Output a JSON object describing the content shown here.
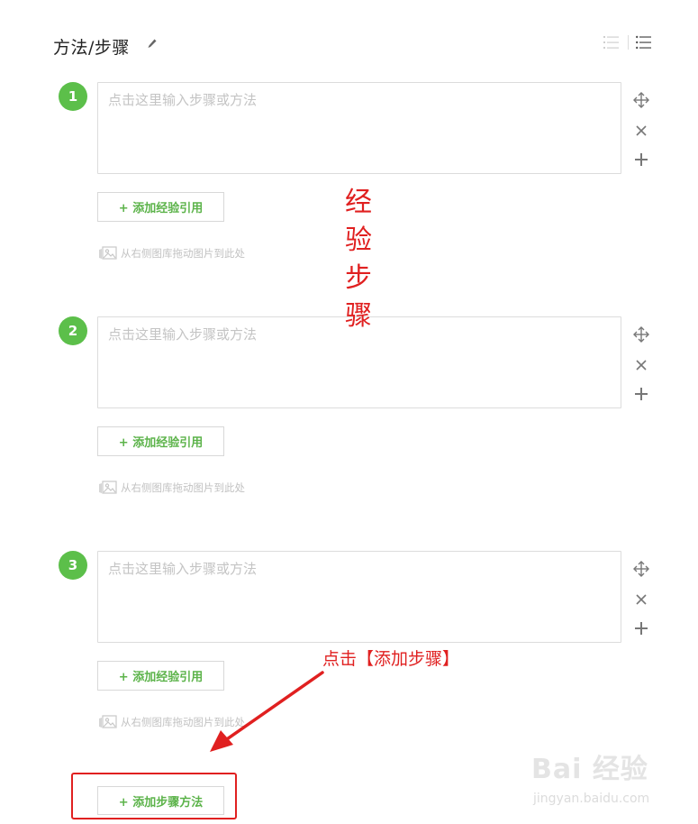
{
  "header": {
    "title": "方法/步骤",
    "edit_icon": "pencil-icon",
    "view_icons": [
      "numbered-list-icon",
      "bullet-list-icon"
    ]
  },
  "steps": [
    {
      "number": "1",
      "placeholder": "点击这里输入步骤或方法",
      "ref_label": "+ 添加经验引用",
      "drag_hint": "从右侧图库拖动图片到此处"
    },
    {
      "number": "2",
      "placeholder": "点击这里输入步骤或方法",
      "ref_label": "+ 添加经验引用",
      "drag_hint": "从右侧图库拖动图片到此处"
    },
    {
      "number": "3",
      "placeholder": "点击这里输入步骤或方法",
      "ref_label": "+ 添加经验引用",
      "drag_hint": "从右侧图库拖动图片到此处"
    }
  ],
  "step_tools": [
    "move-icon",
    "close-icon",
    "plus-icon"
  ],
  "footer": {
    "add_step_label": "+ 添加步骤方法"
  },
  "annotations": {
    "vertical_chars": [
      "经",
      "验",
      "步",
      "骤"
    ],
    "click_hint": "点击【添加步骤】",
    "color": "#e02020"
  },
  "watermark": {
    "logo": "Bai 经验",
    "url": "jingyan.baidu.com"
  },
  "colors": {
    "accent_green": "#5cbf4a",
    "button_text_green": "#5cb34a"
  }
}
